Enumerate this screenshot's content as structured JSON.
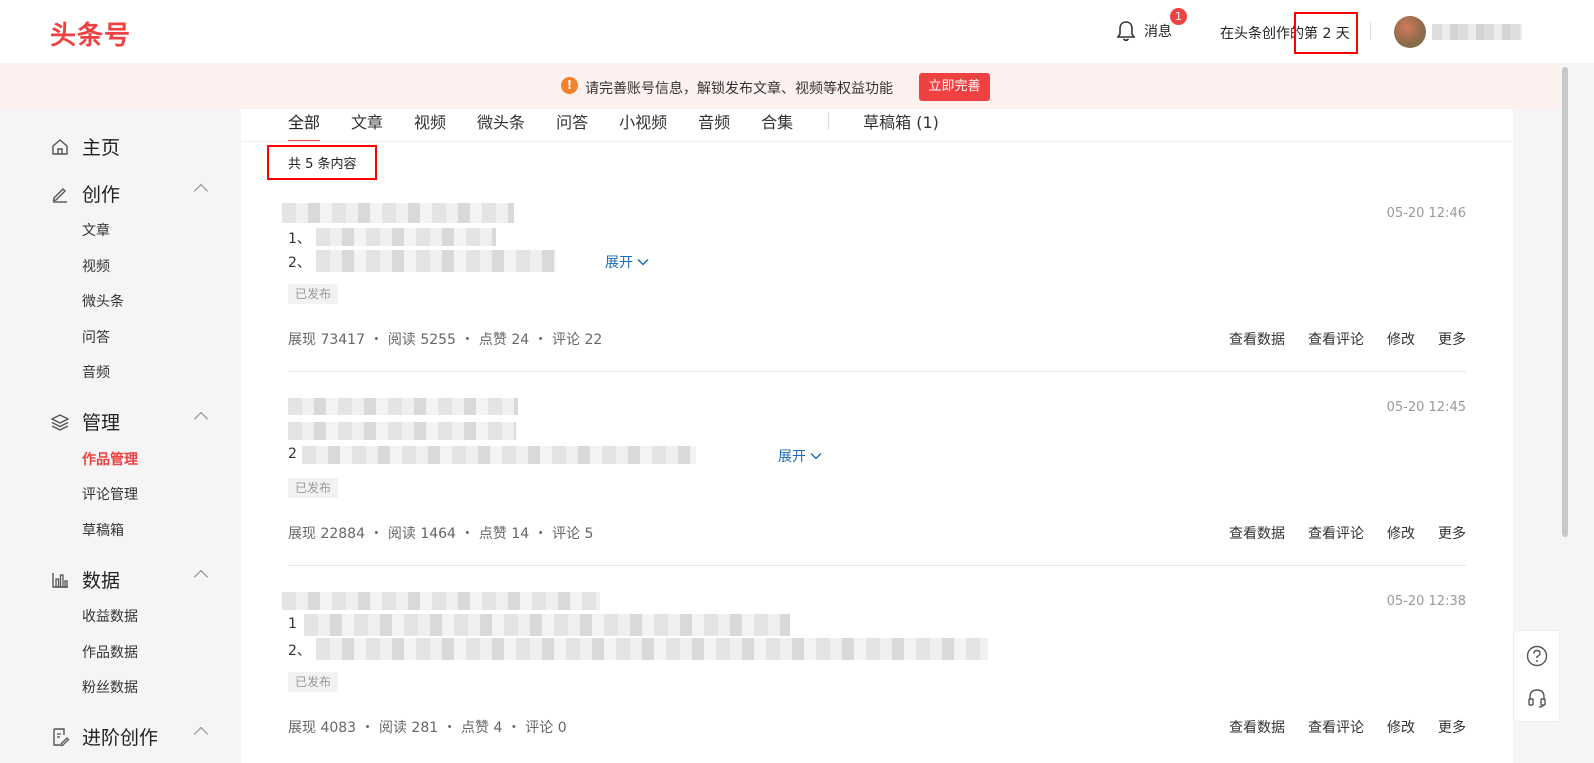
{
  "header": {
    "logo": "头条号",
    "messages_label": "消息",
    "messages_badge": "1",
    "creation_days": "在头条创作的第 2 天"
  },
  "notice": {
    "text": "请完善账号信息，解锁发布文章、视频等权益功能",
    "button": "立即完善"
  },
  "sidebar": {
    "home": "主页",
    "create": {
      "label": "创作",
      "items": [
        "文章",
        "视频",
        "微头条",
        "问答",
        "音频"
      ]
    },
    "manage": {
      "label": "管理",
      "items": [
        "作品管理",
        "评论管理",
        "草稿箱"
      ]
    },
    "data": {
      "label": "数据",
      "items": [
        "收益数据",
        "作品数据",
        "粉丝数据"
      ]
    },
    "advanced": {
      "label": "进阶创作"
    }
  },
  "tabs": [
    "全部",
    "文章",
    "视频",
    "微头条",
    "问答",
    "小视频",
    "音频",
    "合集"
  ],
  "drafts_tab": "草稿箱 (1)",
  "content_count": "共 5 条内容",
  "items": [
    {
      "time": "05-20 12:46",
      "line1_prefix": "1、",
      "line2_prefix": "2、",
      "expand": "展开",
      "status": "已发布",
      "stats": "展现 73417 ・ 阅读 5255 ・ 点赞 24 ・ 评论 22"
    },
    {
      "time": "05-20 12:45",
      "line2_prefix": "2",
      "expand": "展开",
      "status": "已发布",
      "stats": "展现 22884 ・ 阅读 1464 ・ 点赞 14 ・ 评论 5"
    },
    {
      "time": "05-20 12:38",
      "line1_prefix": "1",
      "line2_prefix": "2、",
      "status": "已发布",
      "stats": "展现 4083 ・ 阅读 281 ・ 点赞 4 ・ 评论 0"
    }
  ],
  "actions": [
    "查看数据",
    "查看评论",
    "修改",
    "更多"
  ],
  "colors": {
    "brand": "#f04142",
    "link": "#1a6ab8",
    "annotation": "#ff0000"
  }
}
